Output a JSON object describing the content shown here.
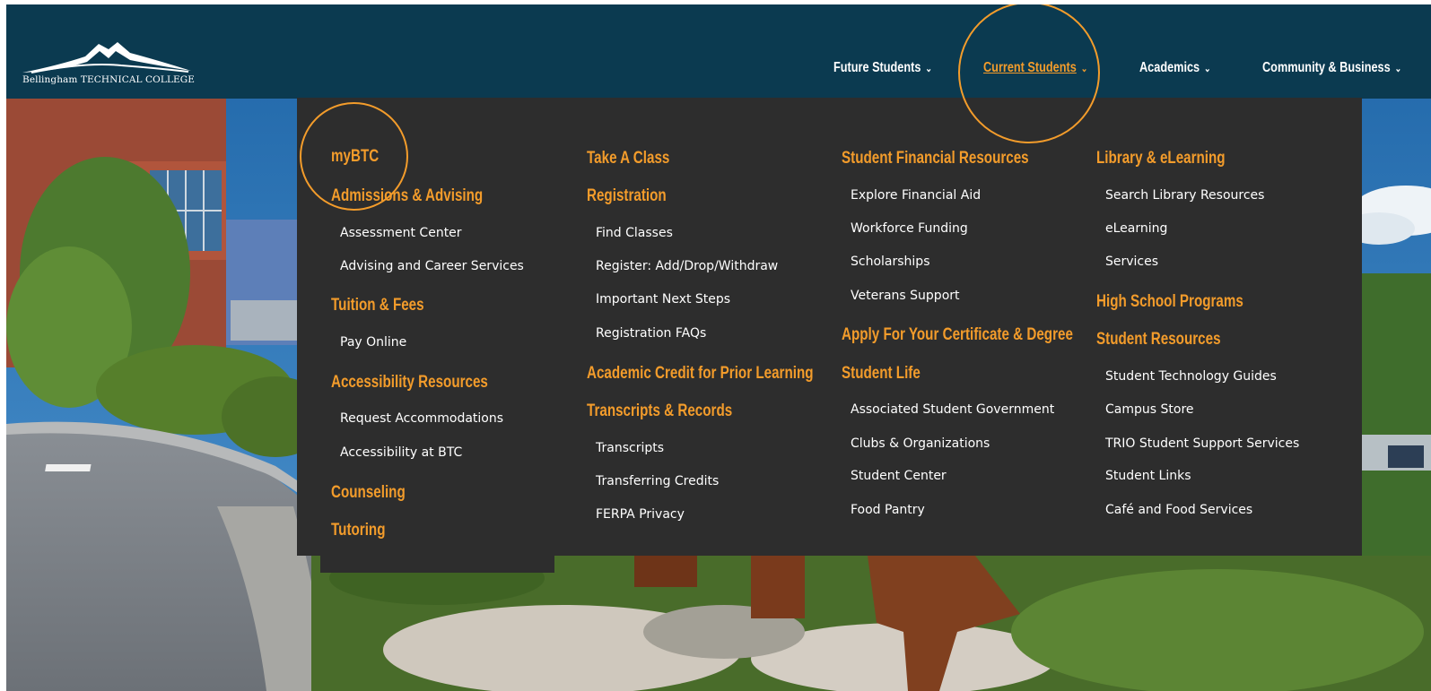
{
  "site": {
    "logo_text": "Bellingham TECHNICAL COLLEGE"
  },
  "colors": {
    "header_bg": "#0b3a50",
    "dropdown_bg": "#2d2d2d",
    "accent": "#f39c2b",
    "link": "#ffffff"
  },
  "nav": [
    {
      "label": "Future Students",
      "active": false
    },
    {
      "label": "Current Students",
      "active": true
    },
    {
      "label": "Academics",
      "active": false
    },
    {
      "label": "Community & Business",
      "active": false
    }
  ],
  "menu": {
    "col1": {
      "mybtc": "myBTC",
      "admissions": "Admissions & Advising",
      "assessment": "Assessment Center",
      "advising": "Advising and Career Services",
      "tuition": "Tuition & Fees",
      "pay": "Pay Online",
      "accessibility": "Accessibility Resources",
      "request": "Request Accommodations",
      "access_btc": "Accessibility at BTC",
      "counseling": "Counseling",
      "tutoring": "Tutoring"
    },
    "col2": {
      "take": "Take A Class",
      "registration": "Registration",
      "find": "Find Classes",
      "register": "Register: Add/Drop/Withdraw",
      "next": "Important Next Steps",
      "faqs": "Registration FAQs",
      "credit": "Academic Credit for Prior Learning",
      "transcripts_records": "Transcripts & Records",
      "transcripts": "Transcripts",
      "transferring": "Transferring Credits",
      "ferpa": "FERPA Privacy"
    },
    "col3": {
      "financial": "Student Financial Resources",
      "explore": "Explore Financial Aid",
      "workforce": "Workforce Funding",
      "scholarships": "Scholarships",
      "veterans": "Veterans Support",
      "apply": "Apply For Your Certificate & Degree",
      "life": "Student Life",
      "asg": "Associated Student Government",
      "clubs": "Clubs & Organizations",
      "center": "Student Center",
      "pantry": "Food Pantry"
    },
    "col4": {
      "library": "Library & eLearning",
      "search": "Search Library Resources",
      "elearning": "eLearning",
      "services": "Services",
      "hs": "High School Programs",
      "resources": "Student Resources",
      "tech": "Student Technology Guides",
      "store": "Campus Store",
      "trio": "TRIO Student Support Services",
      "links": "Student Links",
      "cafe": "Café and Food Services"
    }
  }
}
